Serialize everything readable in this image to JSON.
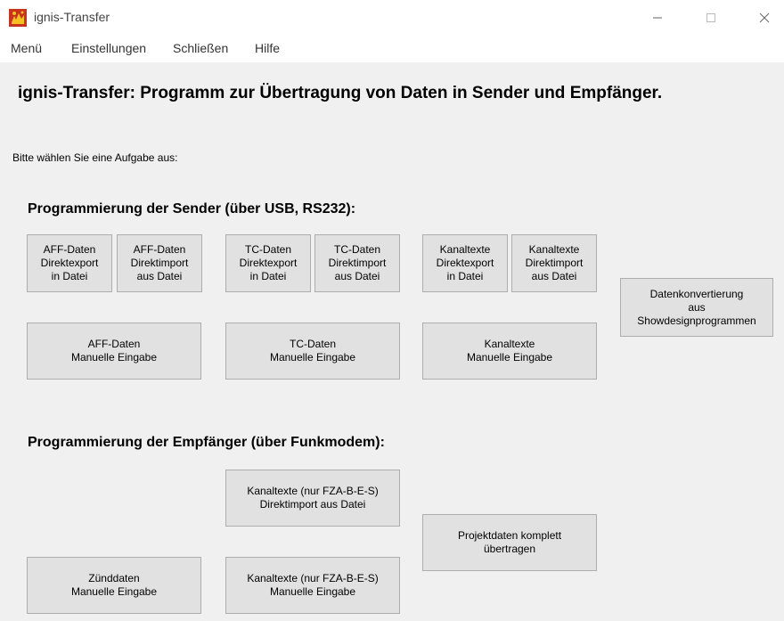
{
  "window": {
    "title": "ignis-Transfer",
    "minimize_icon": "minimize-icon",
    "maximize_icon": "maximize-icon",
    "close_icon": "close-icon"
  },
  "menu": {
    "items": [
      "Menü",
      "Einstellungen",
      "Schließen",
      "Hilfe"
    ]
  },
  "main": {
    "heading": "ignis-Transfer: Programm zur Übertragung von Daten in Sender und Empfänger.",
    "prompt": "Bitte wählen Sie eine Aufgabe aus:"
  },
  "sender": {
    "title": "Programmierung der Sender (über USB, RS232):",
    "aff_export": "AFF-Daten\nDirektexport\nin Datei",
    "aff_import": "AFF-Daten\nDirektimport\naus Datei",
    "tc_export": "TC-Daten\nDirektexport\nin Datei",
    "tc_import": "TC-Daten\nDirektimport\naus Datei",
    "kanal_export": "Kanaltexte\nDirektexport\nin Datei",
    "kanal_import": "Kanaltexte\nDirektimport\naus Datei",
    "konvertierung": "Datenkonvertierung\naus\nShowdesignprogrammen",
    "aff_manual": "AFF-Daten\nManuelle Eingabe",
    "tc_manual": "TC-Daten\nManuelle Eingabe",
    "kanal_manual": "Kanaltexte\nManuelle Eingabe"
  },
  "empfaenger": {
    "title": "Programmierung der Empfänger (über Funkmodem):",
    "kanal_import": "Kanaltexte (nur FZA-B-E-S)\nDirektimport aus Datei",
    "projekt": "Projektdaten komplett\nübertragen",
    "zuend_manual": "Zünddaten\nManuelle Eingabe",
    "kanal_manual": "Kanaltexte (nur FZA-B-E-S)\nManuelle Eingabe"
  }
}
